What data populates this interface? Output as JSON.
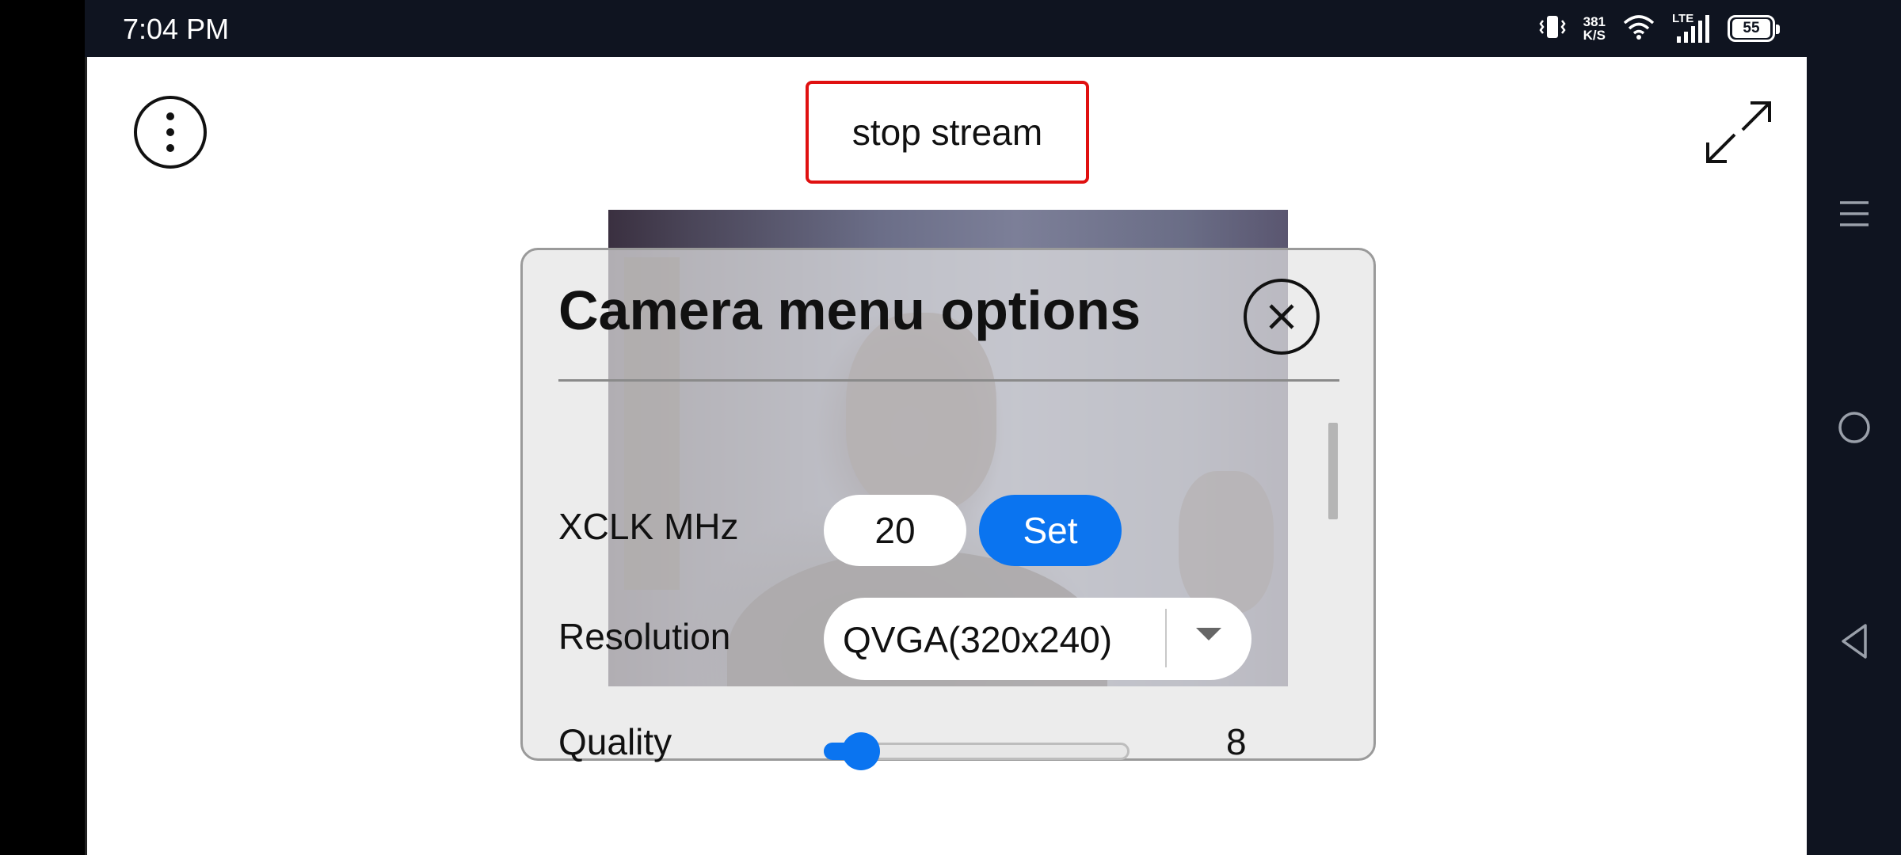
{
  "status_bar": {
    "time": "7:04 PM",
    "net_speed_value": "381",
    "net_speed_unit": "K/S",
    "network_type": "LTE",
    "battery": "55",
    "icons": [
      "vibrate-icon",
      "wifi-icon",
      "signal-icon",
      "battery-icon"
    ]
  },
  "toolbar": {
    "menu_icon": "vertical-dots-icon",
    "stream_button_label": "stop stream",
    "fullscreen_icon": "expand-arrows-icon",
    "stream_button_border_color": "#e01010"
  },
  "camera_menu": {
    "title": "Camera menu options",
    "close_icon": "close-icon",
    "xclk": {
      "label": "XCLK MHz",
      "value": "20",
      "set_label": "Set"
    },
    "resolution": {
      "label": "Resolution",
      "selected": "QVGA(320x240)"
    },
    "quality": {
      "label": "Quality",
      "value": "8",
      "min": 4,
      "max": 63
    }
  },
  "nav_bar": {
    "icons": [
      "menu-icon",
      "home-icon",
      "back-icon"
    ]
  },
  "colors": {
    "accent": "#0a74f0",
    "status_bar_bg": "#0f1420",
    "panel_bg": "#e4e4e4"
  }
}
